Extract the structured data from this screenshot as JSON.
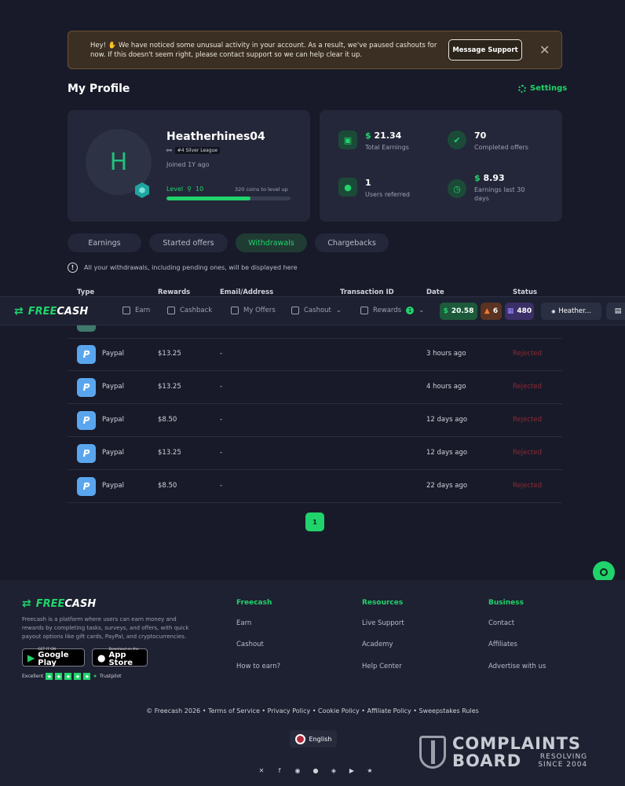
{
  "alert": {
    "message": "Hey! ✋ We have noticed some unusual activity in your account. As a result, we've paused cashouts for now. If this doesn't seem right, please contact support so we can help clear it up.",
    "button": "Message Support",
    "close": "✕"
  },
  "page": {
    "title": "My Profile",
    "settings": "Settings"
  },
  "profile": {
    "initial": "H",
    "username": "Heatherhines04",
    "league": "#4 Silver League",
    "joined": "Joined 1Y ago",
    "level_label": "Level",
    "level": "10",
    "next": "320 coins to level up",
    "progress": 0.68
  },
  "stats": [
    {
      "value": "21.34",
      "currency": "$",
      "label": "Total Earnings"
    },
    {
      "value": "70",
      "currency": "",
      "label": "Completed offers"
    },
    {
      "value": "1",
      "currency": "",
      "label": "Users referred"
    },
    {
      "value": "8.93",
      "currency": "$",
      "label": "Earnings last 30 days"
    }
  ],
  "tabs": [
    "Earnings",
    "Started offers",
    "Withdrawals",
    "Chargebacks"
  ],
  "info": "All your withdrawals, including pending ones, will be displayed here",
  "table": {
    "headers": [
      "Type",
      "Rewards",
      "Email/Address",
      "Transaction ID",
      "Date",
      "Status"
    ],
    "rows": [
      {
        "type": "Paypal",
        "reward": "$13.25",
        "address": "-",
        "date": "3 hours ago",
        "status": "Rejected"
      },
      {
        "type": "Paypal",
        "reward": "$13.25",
        "address": "-",
        "date": "4 hours ago",
        "status": "Rejected"
      },
      {
        "type": "Paypal",
        "reward": "$8.50",
        "address": "-",
        "date": "12 days ago",
        "status": "Rejected"
      },
      {
        "type": "Paypal",
        "reward": "$13.25",
        "address": "-",
        "date": "12 days ago",
        "status": "Rejected"
      },
      {
        "type": "Paypal",
        "reward": "$8.50",
        "address": "-",
        "date": "22 days ago",
        "status": "Rejected"
      }
    ]
  },
  "pagination": {
    "current": "1"
  },
  "nav": {
    "logo_a": "FREE",
    "logo_b": "CASH",
    "items": [
      "Earn",
      "Cashback",
      "My Offers",
      "Cashout",
      "Rewards"
    ],
    "rewards_badge": "1",
    "balance": "20.58",
    "streak": "6",
    "tickets": "480",
    "user": "Heather..."
  },
  "footer": {
    "description": "Freecash is a platform where users can earn money and rewards by completing tasks, surveys, and offers, with quick payout options like gift cards, PayPal, and cryptocurrencies.",
    "google_small": "GET IT ON",
    "google": "Google Play",
    "apple_small": "Download on the",
    "apple": "App Store",
    "trust_label": "Excellent",
    "trust_brand": "Trustpilot",
    "cols": [
      {
        "title": "Freecash",
        "links": [
          "Earn",
          "Cashout",
          "How to earn?"
        ]
      },
      {
        "title": "Resources",
        "links": [
          "Live Support",
          "Academy",
          "Help Center"
        ]
      },
      {
        "title": "Business",
        "links": [
          "Contact",
          "Affiliates",
          "Advertise with us"
        ]
      }
    ],
    "legal": "© Freecash 2026  •  Terms of Service  •  Privacy Policy  •  Cookie Policy  •  Affiliate Policy  •  Sweepstakes Rules",
    "language": "English"
  },
  "watermark": {
    "line1": "COMPLAINTS",
    "line2": "BOARD",
    "line3": "RESOLVING SINCE 2004"
  }
}
